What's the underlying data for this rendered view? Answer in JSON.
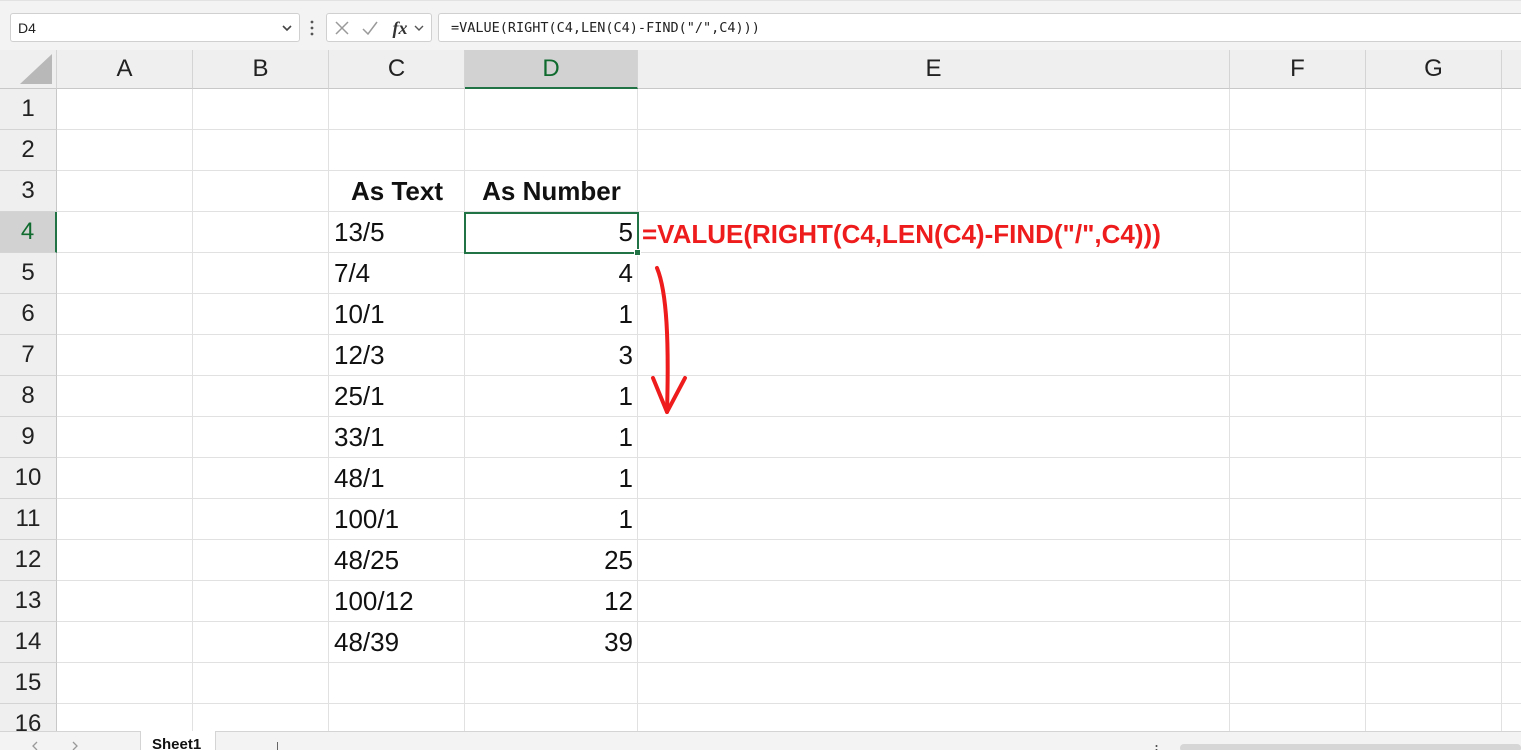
{
  "formula_bar": {
    "name_box": "D4",
    "formula": "=VALUE(RIGHT(C4,LEN(C4)-FIND(\"/\",C4)))",
    "icons": [
      "chevron-down-icon",
      "more-vert-icon",
      "cancel-x-icon",
      "enter-check-icon",
      "fx-icon"
    ],
    "fx_label": "fx"
  },
  "grid": {
    "columns": [
      "A",
      "B",
      "C",
      "D",
      "E",
      "F",
      "G"
    ],
    "selected_column": "D",
    "rows": [
      "1",
      "2",
      "3",
      "4",
      "5",
      "6",
      "7",
      "8",
      "9",
      "10",
      "11",
      "12",
      "13",
      "14",
      "15",
      "16"
    ],
    "selected_row": "4",
    "active_cell": "D4",
    "header_as_text": "As Text",
    "header_as_number": "As Number",
    "data_rows": [
      {
        "row": "4",
        "text": "13/5",
        "number": "5"
      },
      {
        "row": "5",
        "text": "7/4",
        "number": "4"
      },
      {
        "row": "6",
        "text": "10/1",
        "number": "1"
      },
      {
        "row": "7",
        "text": "12/3",
        "number": "3"
      },
      {
        "row": "8",
        "text": "25/1",
        "number": "1"
      },
      {
        "row": "9",
        "text": "33/1",
        "number": "1"
      },
      {
        "row": "10",
        "text": "48/1",
        "number": "1"
      },
      {
        "row": "11",
        "text": "100/1",
        "number": "1"
      },
      {
        "row": "12",
        "text": "48/25",
        "number": "25"
      },
      {
        "row": "13",
        "text": "100/12",
        "number": "12"
      },
      {
        "row": "14",
        "text": "48/39",
        "number": "39"
      }
    ]
  },
  "annotation": {
    "formula_text": "=VALUE(RIGHT(C4,LEN(C4)-FIND(\"/\",C4)))",
    "color": "#ee1c1c",
    "arrow": "down-arrow-icon"
  },
  "sheet_tabs": {
    "tabs": [
      "Sheet1"
    ],
    "active": "Sheet1"
  },
  "colors": {
    "accent": "#217346",
    "header_bg": "#efefef",
    "selected_header_bg": "#d2d2d2",
    "annotation": "#ee1c1c"
  }
}
